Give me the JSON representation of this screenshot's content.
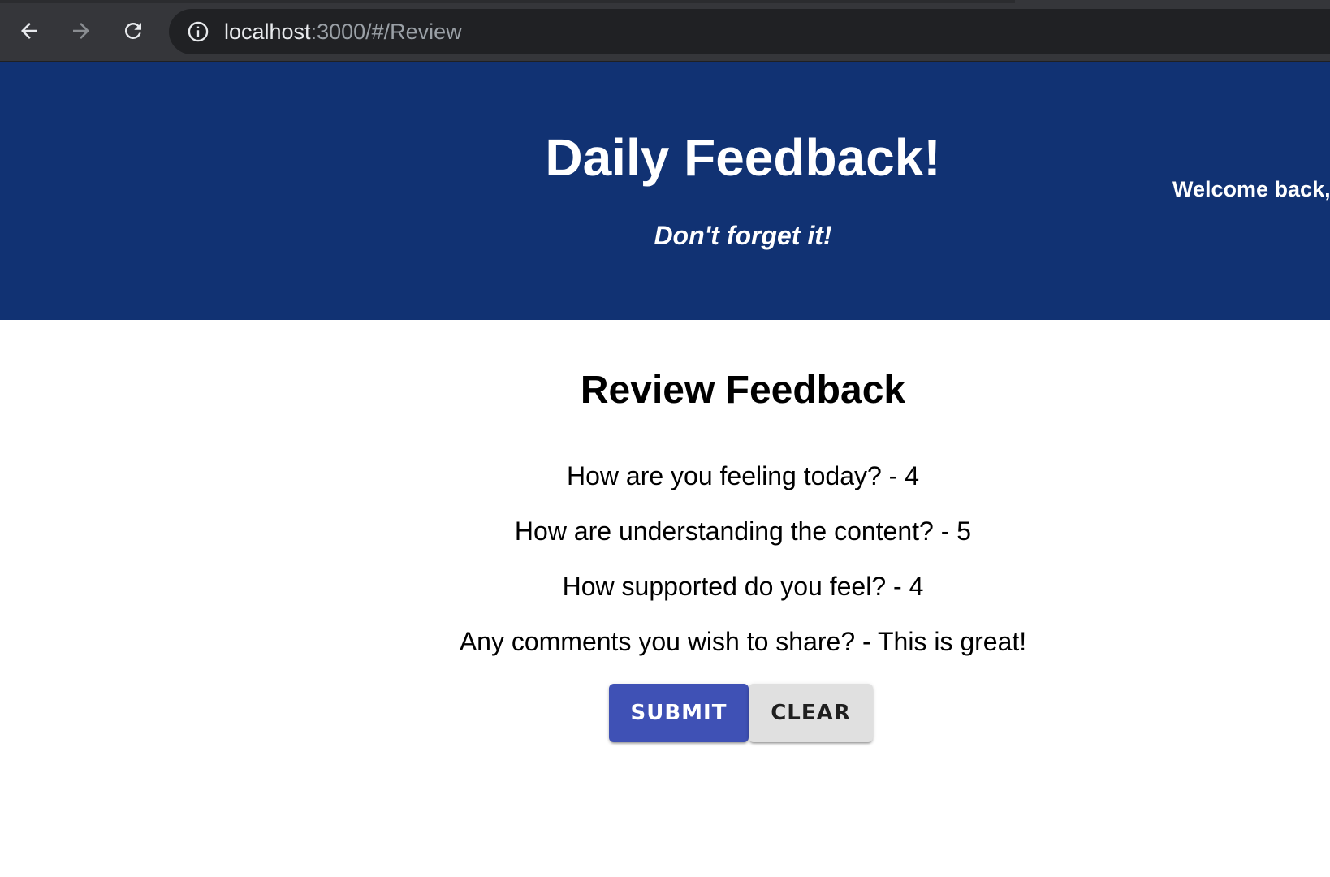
{
  "browser": {
    "url_host": "localhost",
    "url_rest": ":3000/#/Review",
    "icons": {
      "back": "arrow-left-icon",
      "forward": "arrow-right-icon",
      "reload": "reload-icon",
      "site_info": "info-icon"
    }
  },
  "header": {
    "title": "Daily Feedback!",
    "subtitle": "Don't forget it!",
    "welcome": "Welcome back,",
    "background_color": "#113273"
  },
  "review": {
    "heading": "Review Feedback",
    "lines": [
      "How are you feeling today? - 4",
      "How are understanding the content? - 5",
      "How supported do you feel? - 4",
      "Any comments you wish to share? - This is great!"
    ],
    "submit_label": "SUBMIT",
    "clear_label": "CLEAR",
    "submit_color": "#3f51b5",
    "clear_color": "#e0e0e0"
  }
}
